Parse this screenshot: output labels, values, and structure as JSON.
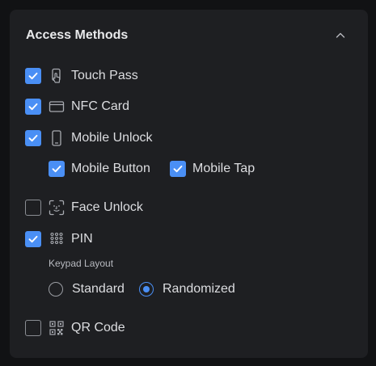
{
  "section": {
    "title": "Access Methods",
    "collapse_icon": "chevron-up-icon"
  },
  "methods": {
    "touch_pass": {
      "label": "Touch Pass",
      "checked": true,
      "icon": "phone-tap-icon"
    },
    "nfc_card": {
      "label": "NFC Card",
      "checked": true,
      "icon": "card-icon"
    },
    "mobile_unlock": {
      "label": "Mobile Unlock",
      "checked": true,
      "icon": "smartphone-icon"
    },
    "mobile_button": {
      "label": "Mobile Button",
      "checked": true
    },
    "mobile_tap": {
      "label": "Mobile Tap",
      "checked": true
    },
    "face_unlock": {
      "label": "Face Unlock",
      "checked": false,
      "icon": "face-scan-icon"
    },
    "pin": {
      "label": "PIN",
      "checked": true,
      "icon": "keypad-icon"
    },
    "qr_code": {
      "label": "QR Code",
      "checked": false,
      "icon": "qr-code-icon"
    }
  },
  "keypad_layout": {
    "label": "Keypad Layout",
    "options": [
      {
        "label": "Standard",
        "selected": false
      },
      {
        "label": "Randomized",
        "selected": true
      }
    ]
  },
  "colors": {
    "accent": "#4a8ff5",
    "panel_bg": "#1e1f22",
    "page_bg": "#111214",
    "text": "#dcdde0"
  }
}
